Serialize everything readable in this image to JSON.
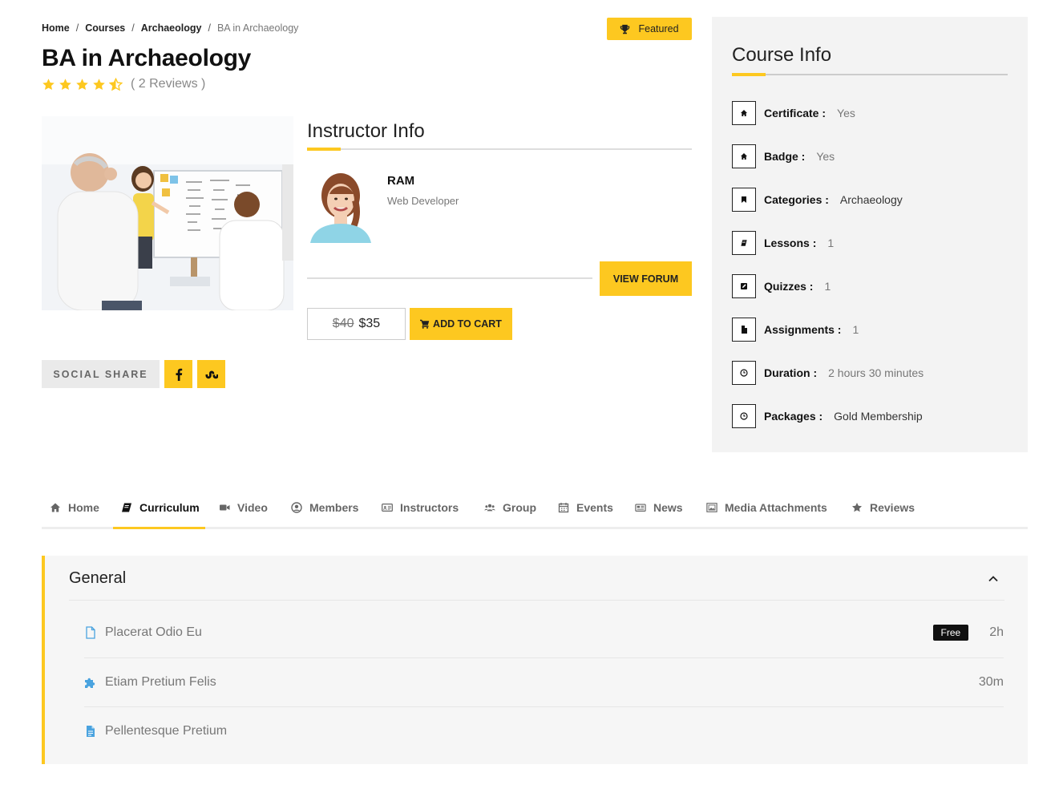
{
  "breadcrumb": {
    "items": [
      "Home",
      "Courses",
      "Archaeology"
    ],
    "current": "BA in Archaeology",
    "separator": "/"
  },
  "featured_label": "Featured",
  "course": {
    "title": "BA in Archaeology",
    "rating": 4.5,
    "reviews_text": "( 2 Reviews )"
  },
  "instructor": {
    "section_title": "Instructor Info",
    "name": "RAM",
    "role": "Web Developer",
    "forum_button": "VIEW FORUM"
  },
  "pricing": {
    "old_price": "$40",
    "price": "$35",
    "add_to_cart": "ADD TO CART"
  },
  "social": {
    "label": "SOCIAL SHARE",
    "buttons": [
      "facebook-icon",
      "stumbleupon-icon"
    ]
  },
  "course_info": {
    "title": "Course Info",
    "rows": [
      {
        "label": "Certificate :",
        "value": "Yes",
        "icon": "home-icon"
      },
      {
        "label": "Badge :",
        "value": "Yes",
        "icon": "home-icon"
      },
      {
        "label": "Categories :",
        "value": "Archaeology",
        "icon": "bookmark-icon"
      },
      {
        "label": "Lessons :",
        "value": "1",
        "icon": "book-icon"
      },
      {
        "label": "Quizzes :",
        "value": "1",
        "icon": "edit-icon"
      },
      {
        "label": "Assignments :",
        "value": "1",
        "icon": "file-icon"
      },
      {
        "label": "Duration :",
        "value": "2 hours 30 minutes",
        "icon": "clock-icon"
      },
      {
        "label": "Packages :",
        "value": "Gold Membership",
        "icon": "clock-icon"
      }
    ]
  },
  "tabs": [
    {
      "label": "Home",
      "icon": "home-icon"
    },
    {
      "label": "Curriculum",
      "icon": "book-icon",
      "active": true
    },
    {
      "label": "Video",
      "icon": "video-icon"
    },
    {
      "label": "Members",
      "icon": "user-circle-icon"
    },
    {
      "label": "Instructors",
      "icon": "id-card-icon"
    },
    {
      "label": "Group",
      "icon": "group-icon"
    },
    {
      "label": "Events",
      "icon": "calendar-icon"
    },
    {
      "label": "News",
      "icon": "newspaper-icon"
    },
    {
      "label": "Media Attachments",
      "icon": "image-icon"
    },
    {
      "label": "Reviews",
      "icon": "star-icon"
    }
  ],
  "curriculum": {
    "section_title": "General",
    "lessons": [
      {
        "name": "Placerat Odio Eu",
        "badge": "Free",
        "duration": "2h",
        "icon": "document-outline-icon"
      },
      {
        "name": "Etiam Pretium Felis",
        "badge": "",
        "duration": "30m",
        "icon": "puzzle-icon"
      },
      {
        "name": "Pellentesque Pretium",
        "badge": "",
        "duration": "",
        "icon": "document-icon"
      }
    ]
  },
  "colors": {
    "accent": "#fdc820",
    "panel": "#f3f3f3",
    "lesson_icon": "#4aa3df"
  }
}
